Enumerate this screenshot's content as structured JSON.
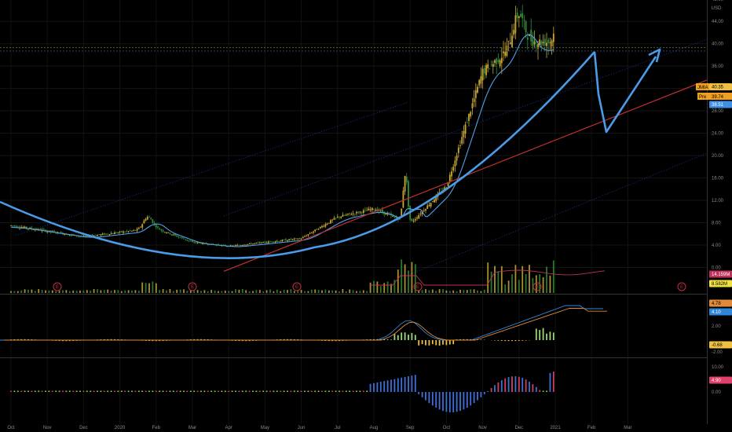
{
  "currency_label": "USD",
  "colors": {
    "background": "#000000",
    "up": "#c8a832",
    "down": "#2f8f3a",
    "ma": "#4fa3e8",
    "trend_curve": "#4a9be8",
    "resistance": "#d0302f",
    "trendline": "#c0302f",
    "channel": "#1f3fb0",
    "vol_ma": "#c0305a",
    "macd_line": "#2f86d8",
    "signal_line": "#e08a3a",
    "hist_pos": "#9ad87a",
    "hist_neg": "#f0c040",
    "osc_pos_blue": "#3f6fd8",
    "osc_pos_red": "#d04060",
    "osc_neg": "#3f6fd8",
    "osc_small": "#a0d040"
  },
  "price_axis_ticks": [
    "56.00",
    "52.00",
    "48.00",
    "44.00",
    "40.00",
    "36.00",
    "32.00",
    "28.00",
    "24.00",
    "20.00",
    "16.00",
    "12.00",
    "8.00",
    "4.00",
    "0.00"
  ],
  "macd_axis_ticks": [
    "2.00",
    "-2.00"
  ],
  "osc_axis_ticks": [
    "10.00",
    "5.00",
    "0.00"
  ],
  "price_badges": [
    {
      "label": "49.77",
      "bg": "#d0302f",
      "fg": "#ffffff"
    },
    {
      "label": "JMIA",
      "bg": "#f0a020",
      "fg": "#000000",
      "name": true
    },
    {
      "label": "40.35",
      "bg": "#f0c040",
      "fg": "#000000"
    },
    {
      "label": "39.74",
      "bg": "#f0a020",
      "fg": "#000000",
      "pre": "Pre"
    },
    {
      "label": "38.51",
      "bg": "#3f8fe8",
      "fg": "#ffffff"
    }
  ],
  "volume_badges": [
    {
      "label": "14.159M",
      "bg": "#c0305a",
      "fg": "#ffffff"
    },
    {
      "label": "8.582M",
      "bg": "#f0e040",
      "fg": "#000000"
    }
  ],
  "macd_badges": [
    {
      "label": "4.78",
      "bg": "#e08a3a",
      "fg": "#000000"
    },
    {
      "label": "4.10",
      "bg": "#2f86d8",
      "fg": "#ffffff"
    },
    {
      "label": "-0.68",
      "bg": "#f0c040",
      "fg": "#000000"
    }
  ],
  "osc_badges": [
    {
      "label": "4.90",
      "bg": "#e0406a",
      "fg": "#ffffff"
    }
  ],
  "x_axis_labels": [
    "Oct",
    "Nov",
    "Dec",
    "2020",
    "Feb",
    "Mar",
    "Apr",
    "May",
    "Jun",
    "Jul",
    "Aug",
    "Sep",
    "Oct",
    "Nov",
    "Dec",
    "2021",
    "Feb",
    "Mar"
  ],
  "earnings_marker": "E",
  "chart_data": {
    "type": "candlestick",
    "symbol": "JMIA",
    "y_range": [
      -2,
      58
    ],
    "resistance_level": 49.77,
    "last_price": 40.35,
    "premarket_price": 39.74,
    "ma_value": 38.51,
    "monthly_close": [
      {
        "month": "Oct 2019",
        "close": 7.5
      },
      {
        "month": "Nov 2019",
        "close": 6.5
      },
      {
        "month": "Dec 2019",
        "close": 5.5
      },
      {
        "month": "Jan 2020",
        "close": 6.3
      },
      {
        "month": "Feb 2020",
        "close": 7.0
      },
      {
        "month": "Mar 2020",
        "close": 4.5
      },
      {
        "month": "Apr 2020",
        "close": 3.8
      },
      {
        "month": "May 2020",
        "close": 4.5
      },
      {
        "month": "Jun 2020",
        "close": 5.2
      },
      {
        "month": "Jul 2020",
        "close": 9.0
      },
      {
        "month": "Aug 2020",
        "close": 10.5
      },
      {
        "month": "Sep 2020",
        "close": 7.8
      },
      {
        "month": "Oct 2020",
        "close": 14.5
      },
      {
        "month": "Nov 2020",
        "close": 35.0
      },
      {
        "month": "Dec 2020",
        "close": 40.35
      }
    ],
    "volume_ma_value": "14.159M",
    "volume_value": "8.582M",
    "macd": {
      "signal": 4.78,
      "macd": 4.1,
      "histogram": -0.68
    },
    "oscillator_value": 4.9
  }
}
